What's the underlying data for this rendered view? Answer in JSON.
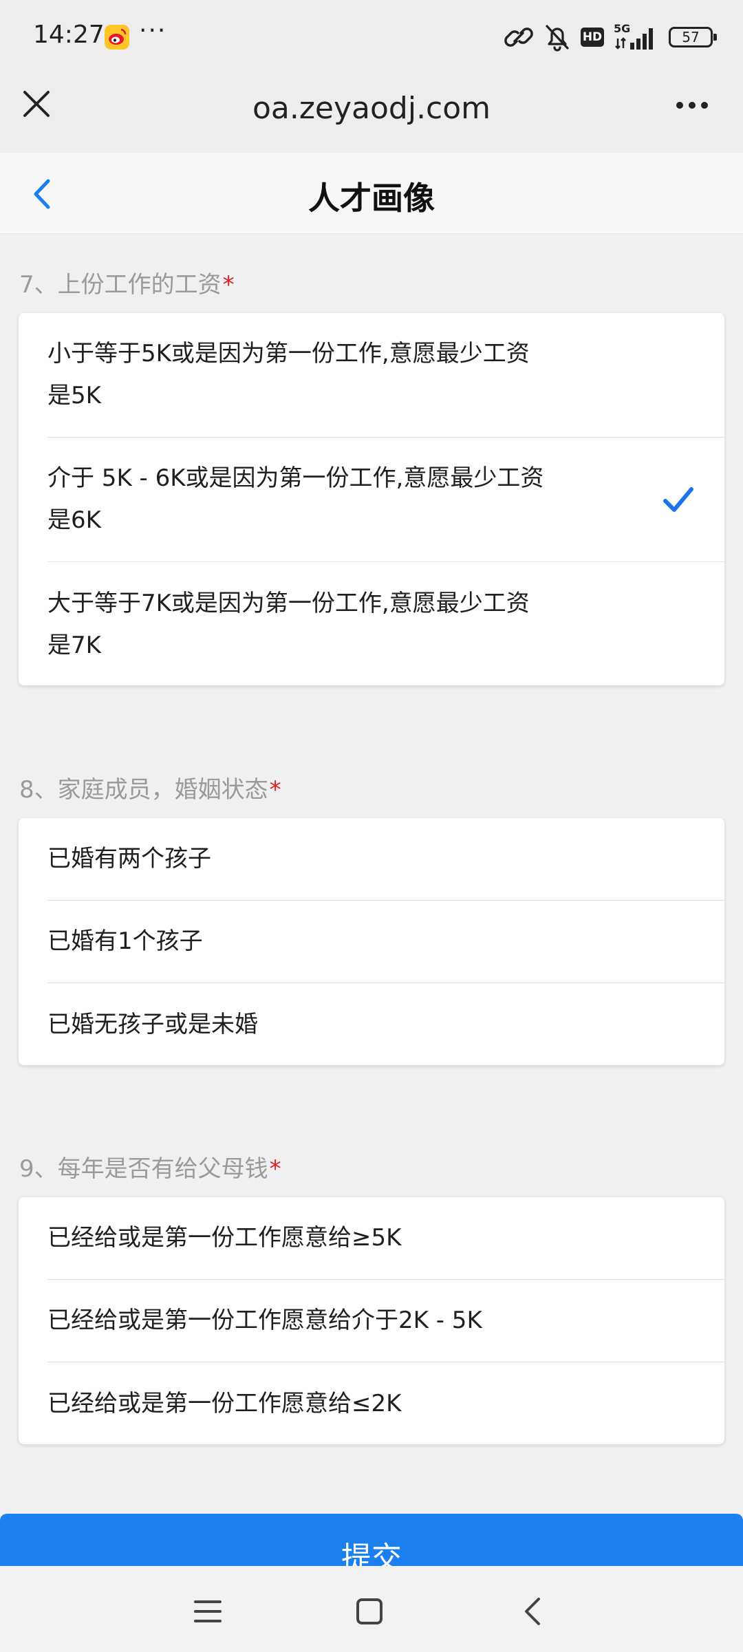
{
  "status_bar": {
    "time": "14:27",
    "more": "···",
    "network": "5G",
    "hd": "HD",
    "battery": "57",
    "icons": [
      "weibo-icon",
      "link-icon",
      "bell-off-icon",
      "hd-icon",
      "signal-icon",
      "battery-icon"
    ]
  },
  "browser": {
    "url": "oa.zeyaodj.com",
    "icons": [
      "close-icon",
      "more-icon"
    ]
  },
  "header": {
    "title": "人才画像",
    "back_icon": "chevron-left-icon"
  },
  "questions": [
    {
      "title": "7、上份工作的工资",
      "required": "*",
      "options": [
        {
          "line1": "小于等于5K或是因为第一份工作,意愿最少工资",
          "line2": "是5K",
          "selected": false
        },
        {
          "line1": "介于 5K - 6K或是因为第一份工作,意愿最少工资",
          "line2": "是6K",
          "selected": true
        },
        {
          "line1": "大于等于7K或是因为第一份工作,意愿最少工资",
          "line2": "是7K",
          "selected": false
        }
      ]
    },
    {
      "title": "8、家庭成员，婚姻状态",
      "required": "*",
      "options": [
        {
          "label": "已婚有两个孩子",
          "selected": false
        },
        {
          "label": "已婚有1个孩子",
          "selected": false
        },
        {
          "label": "已婚无孩子或是未婚",
          "selected": false
        }
      ]
    },
    {
      "title": "9、每年是否有给父母钱",
      "required": "*",
      "options": [
        {
          "label": "已经给或是第一份工作愿意给≥5K",
          "selected": false
        },
        {
          "label": "已经给或是第一份工作愿意给介于2K - 5K",
          "selected": false
        },
        {
          "label": "已经给或是第一份工作愿意给≤2K",
          "selected": false
        }
      ]
    }
  ],
  "submit": {
    "label": "提交"
  },
  "colors": {
    "accent": "#1b7ff0",
    "required": "#e02020",
    "check": "#1a73e8"
  },
  "nav": {
    "icons": [
      "menu-icon",
      "home-icon",
      "back-icon"
    ]
  }
}
